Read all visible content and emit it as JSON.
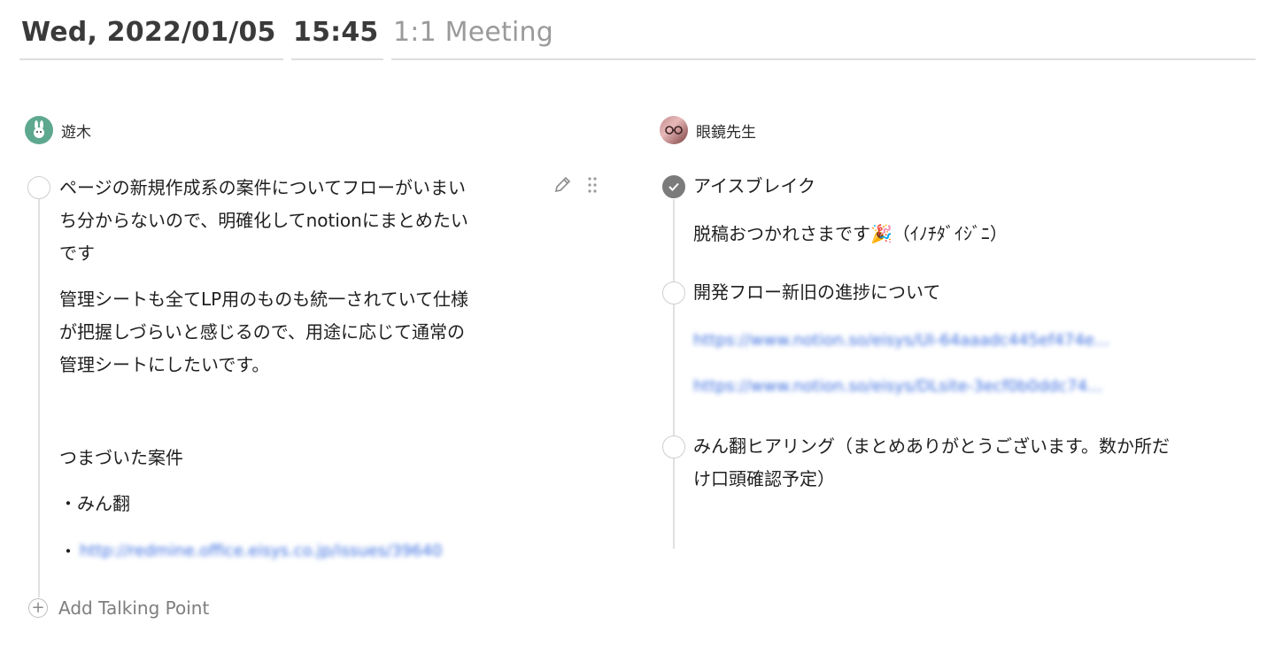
{
  "header": {
    "date": "Wed, 2022/01/05",
    "time": "15:45",
    "title": "1:1 Meeting"
  },
  "left": {
    "user": "遊木",
    "item": {
      "title_lines": [
        "ページの新規作成系の案件についてフローがいまい",
        "ち分からないので、明確化してnotionにまとめたい",
        "です"
      ],
      "body_lines": [
        "管理シートも全てLP用のものも統一されていて仕様",
        "が把握しづらいと感じるので、用途に応じて通常の",
        "管理シートにしたいです。"
      ],
      "related_heading": "つまづいた案件",
      "bullets": [
        "・みん翻",
        "・"
      ],
      "link": "http://redmine.office.eisys.co.jp/issues/39640"
    },
    "add_label": "Add Talking Point"
  },
  "right": {
    "user": "眼鏡先生",
    "items": [
      {
        "title": "アイスブレイク",
        "note": "脱稿おつかれさまです🎉（ｲﾉﾁﾀﾞｲｼﾞﾆ）",
        "done": true
      },
      {
        "title": "開発フロー新旧の進捗について",
        "links": [
          "https://www.notion.so/eisys/UI-64aaadc445ef474e...",
          "https://www.notion.so/eisys/DLsite-3ecf0b0ddc74..."
        ]
      },
      {
        "title_lines": [
          "みん翻ヒアリング（まとめありがとうございます。数か所だ",
          "け口頭確認予定）"
        ]
      }
    ]
  },
  "icons": [
    "pencil-icon",
    "drag-handle-icon",
    "check-icon",
    "plus-icon"
  ]
}
